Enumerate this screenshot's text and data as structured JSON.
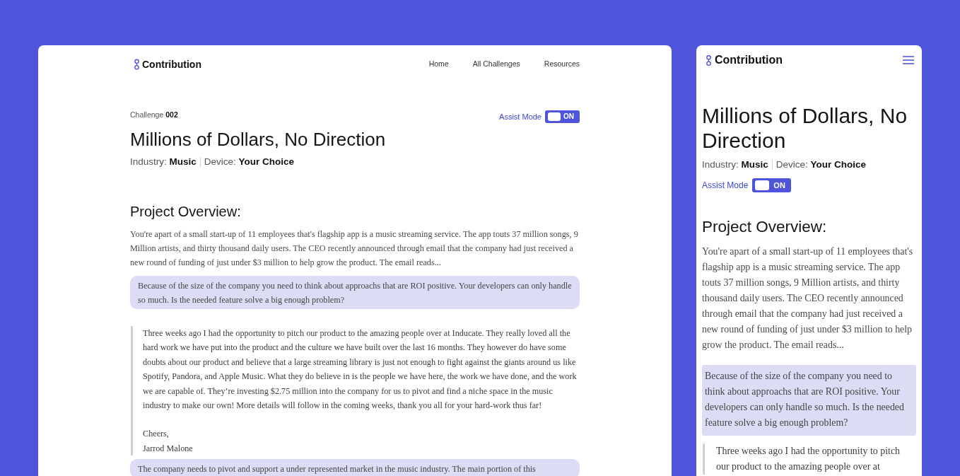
{
  "desktop": {
    "header": {
      "logo": "Contribution",
      "nav": [
        {
          "label": "Home"
        },
        {
          "label": "All Challenges"
        },
        {
          "label": "Resources"
        }
      ]
    },
    "challenge": "Challenge **002**",
    "assist_mode": {
      "label": "Assist Mode",
      "on": true,
      "state_label": "ON"
    },
    "title": "Millions of Dollars, No Direction",
    "meta": [
      "Industry: **Music**",
      "Device: **Your Choice**"
    ],
    "section_heading": "Project Overview:",
    "content": [
      {
        "kind": "paragraph",
        "text": "You're apart of a small start-up of 11 employees that's flagship app is a music streaming service. The app touts 37 million songs, 9 Million artists, and thirty thousand daily users. The CEO recently announced through email that the company had just received a new round of funding of just under $3 million to help grow the product. The email reads..."
      },
      {
        "kind": "callout",
        "text": "Because of the size of the company you need to think about approachs that are ROI positive. Your developers can only handle so much. Is the needed feature solve a big enough problem?"
      },
      {
        "kind": "quote",
        "body": "Three weeks ago I had the opportunity to pitch our product to the amazing people over at Inducate. They really loved all the hard work we have put into the product and the culture we have built over the last 16 months. They however do have some doubts about our product and believe that a large streaming library is just not enough to fight against the giants around us like Spotify, Pandora, and Apple Music. What they do believe in is the people we have here, the work we have done, and the work we are capable of. They’re investing $2.75 million into the company for us to pivot and find a niche space in the music industry to make our own! More details will follow in the coming weeks, thank you all for your hard-work thus far!",
        "signoff": [
          "Cheers,",
          "Jarrod Malone"
        ]
      },
      {
        "kind": "callout",
        "text": "The company needs to pivot and support a under represented market in the music industry. The main portion of this"
      }
    ]
  },
  "mobile": {
    "header": {
      "logo": "Contribution"
    },
    "title": "Millions of Dollars, No Direction",
    "meta": [
      "Industry: **Music**",
      "Device: **Your Choice**"
    ],
    "assist_mode": {
      "label": "Assist Mode",
      "on": true,
      "state_label": "ON"
    },
    "section_heading": "Project Overview:",
    "content": [
      {
        "kind": "paragraph",
        "text": "You're apart of a small start-up of 11 employees that's flagship app is a music streaming service. The app touts 37 million songs, 9 Million artists, and thirty thousand daily users. The CEO recently announced through email that the company had just received a new round of funding of just under $3 million to help grow the product. The email reads..."
      },
      {
        "kind": "callout",
        "text": "Because of the size of the company you need to think about approachs that are ROI positive. Your developers can only handle so much. Is the needed feature solve a big enough problem?"
      },
      {
        "kind": "quote",
        "body": "Three weeks ago I had the opportunity to pitch our product to the amazing people over at"
      }
    ]
  }
}
